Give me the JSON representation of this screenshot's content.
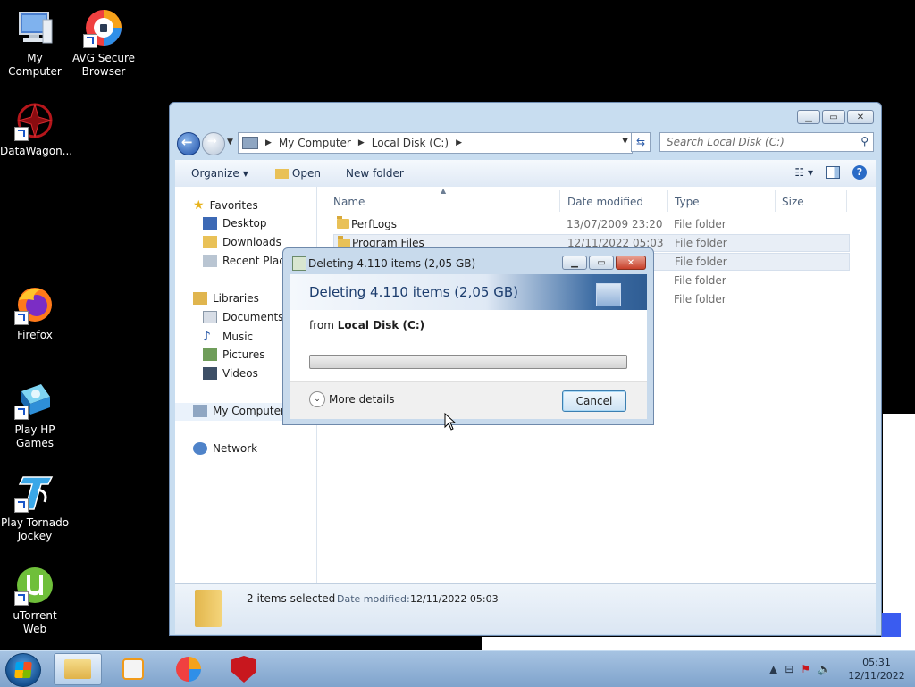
{
  "desktop": {
    "icons": [
      {
        "label": "My Computer"
      },
      {
        "label": "AVG Secure Browser"
      },
      {
        "label": "DataWagon..."
      },
      {
        "label": "Firefox"
      },
      {
        "label": "Play HP Games"
      },
      {
        "label": "Play Tornado Jockey"
      },
      {
        "label": "uTorrent Web"
      }
    ]
  },
  "explorer": {
    "breadcrumb": [
      "My Computer",
      "Local Disk (C:)"
    ],
    "search_placeholder": "Search Local Disk (C:)",
    "toolbar": {
      "organize": "Organize",
      "open": "Open",
      "new_folder": "New folder"
    },
    "nav": {
      "favorites": "Favorites",
      "desktop": "Desktop",
      "downloads": "Downloads",
      "recent": "Recent Places",
      "libraries": "Libraries",
      "documents": "Documents",
      "music": "Music",
      "pictures": "Pictures",
      "videos": "Videos",
      "my_computer": "My Computer",
      "network": "Network"
    },
    "columns": {
      "name": "Name",
      "date": "Date modified",
      "type": "Type",
      "size": "Size"
    },
    "rows": [
      {
        "name": "PerfLogs",
        "date": "13/07/2009 23:20",
        "type": "File folder"
      },
      {
        "name": "Program Files",
        "date": "12/11/2022 05:03",
        "type": "File folder"
      },
      {
        "name": "",
        "date": "",
        "type": "File folder"
      },
      {
        "name": "",
        "date": "",
        "type": "File folder"
      },
      {
        "name": "",
        "date": "",
        "type": "File folder"
      }
    ],
    "status": {
      "selected": "2 items selected",
      "date_label": "Date modified:",
      "date_value": "12/11/2022 05:03"
    }
  },
  "dialog": {
    "title": "Deleting 4.110 items (2,05 GB)",
    "heading": "Deleting 4.110 items (2,05 GB)",
    "from_label": "from",
    "from_value": "Local Disk (C:)",
    "progress": 0,
    "more_details": "More details",
    "cancel": "Cancel"
  },
  "taskbar": {
    "time": "05:31",
    "date": "12/11/2022"
  }
}
